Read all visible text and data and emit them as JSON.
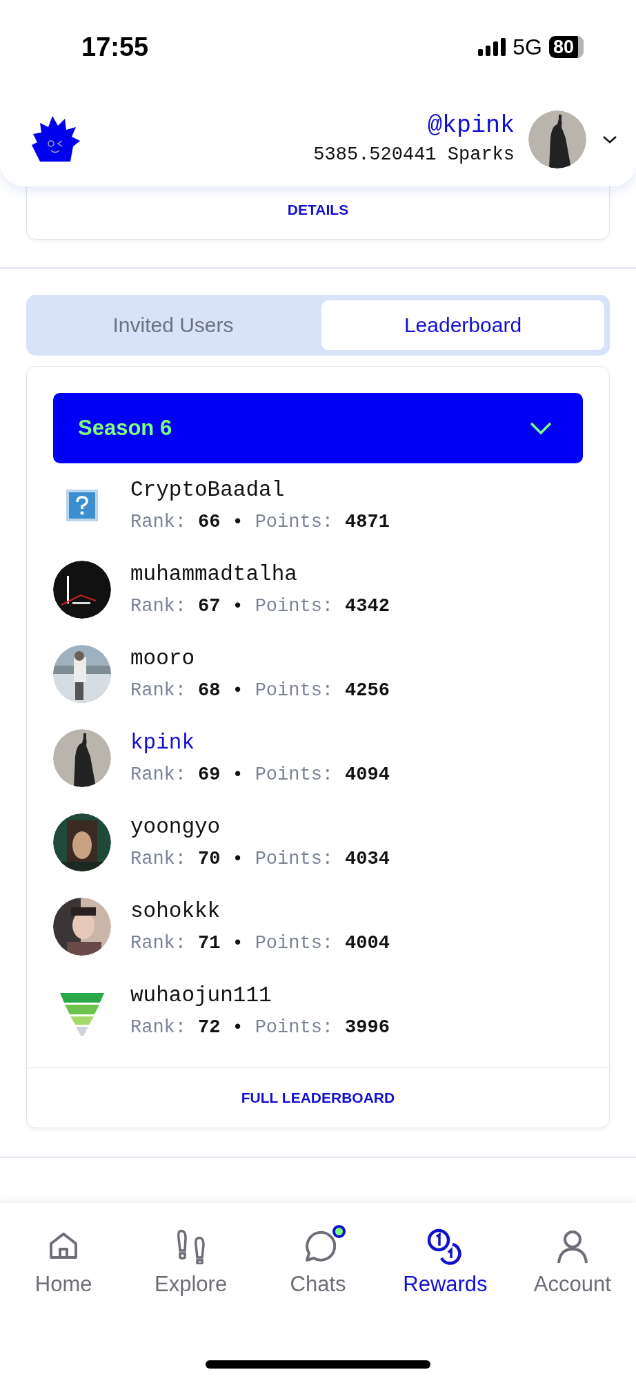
{
  "status_bar": {
    "time": "17:55",
    "network": "5G",
    "battery": "80"
  },
  "header": {
    "handle": "@kpink",
    "balance": "5385.520441 Sparks"
  },
  "details_card": {
    "link": "DETAILS"
  },
  "tabs": [
    {
      "label": "Invited Users",
      "selected": false
    },
    {
      "label": "Leaderboard",
      "selected": true
    }
  ],
  "leaderboard": {
    "season": "Season 6",
    "rows": [
      {
        "kind": "placeholder",
        "name": "CryptoBaadal",
        "rank_label": "Rank:",
        "rank": "66",
        "separator": "•",
        "points_label": "Points:",
        "points": "4871",
        "current": false
      },
      {
        "name": "muhammadtalha",
        "rank_label": "Rank:",
        "rank": "67",
        "separator": "•",
        "points_label": "Points:",
        "points": "4342",
        "current": false
      },
      {
        "name": "mooro",
        "rank_label": "Rank:",
        "rank": "68",
        "separator": "•",
        "points_label": "Points:",
        "points": "4256",
        "current": false
      },
      {
        "name": "kpink",
        "rank_label": "Rank:",
        "rank": "69",
        "separator": "•",
        "points_label": "Points:",
        "points": "4094",
        "current": true
      },
      {
        "name": "yoongyo",
        "rank_label": "Rank:",
        "rank": "70",
        "separator": "•",
        "points_label": "Points:",
        "points": "4034",
        "current": false
      },
      {
        "name": "sohokkk",
        "rank_label": "Rank:",
        "rank": "71",
        "separator": "•",
        "points_label": "Points:",
        "points": "4004",
        "current": false
      },
      {
        "kind": "funnel",
        "name": "wuhaojun111",
        "rank_label": "Rank:",
        "rank": "72",
        "separator": "•",
        "points_label": "Points:",
        "points": "3996",
        "current": false
      }
    ],
    "footer_link": "FULL LEADERBOARD"
  },
  "bottom_nav": [
    {
      "label": "Home",
      "selected": false,
      "notification": false
    },
    {
      "label": "Explore",
      "selected": false,
      "notification": false
    },
    {
      "label": "Chats",
      "selected": false,
      "notification": true
    },
    {
      "label": "Rewards",
      "selected": true,
      "notification": false
    },
    {
      "label": "Account",
      "selected": false,
      "notification": false
    }
  ]
}
